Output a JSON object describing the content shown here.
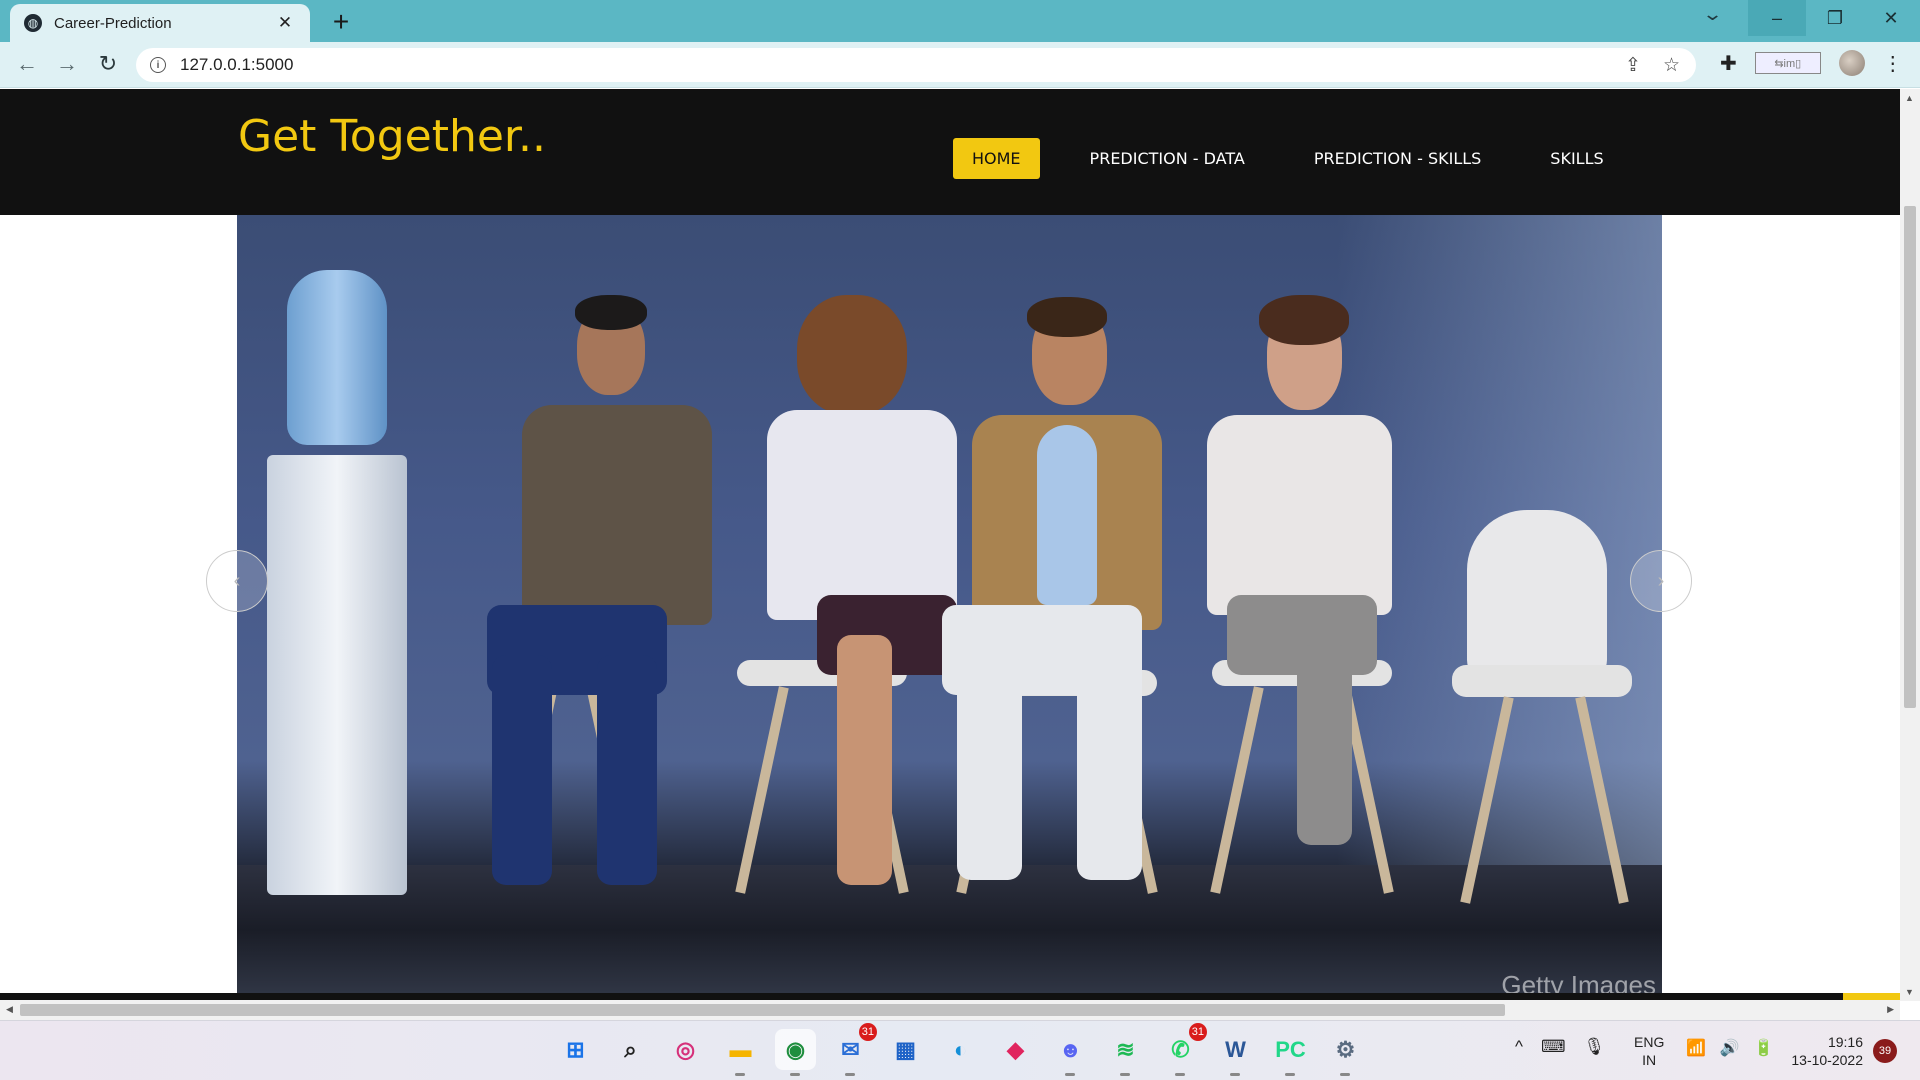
{
  "browser": {
    "tab_title": "Career-Prediction",
    "tab_close": "✕",
    "new_tab": "+",
    "url": "127.0.0.1:5000",
    "window_controls": {
      "minimize": "–",
      "maximize": "❐",
      "close": "✕"
    },
    "nav": {
      "back": "←",
      "forward": "→",
      "reload": "↻"
    },
    "omnibox_icons": {
      "share": "⇪",
      "bookmark": "☆"
    },
    "extension_badge": "⇆im▯"
  },
  "site": {
    "logo": "Get Together..",
    "nav": [
      {
        "label": "HOME",
        "active": true
      },
      {
        "label": "PREDICTION - DATA",
        "active": false
      },
      {
        "label": "PREDICTION - SKILLS",
        "active": false
      },
      {
        "label": "SKILLS",
        "active": false
      }
    ],
    "hero": {
      "watermark": "Getty Images",
      "prev": "‹",
      "next": "›"
    },
    "colors": {
      "accent": "#f2c811",
      "header_bg": "#111111"
    }
  },
  "taskbar": {
    "apps": [
      {
        "name": "start-icon",
        "glyph": "⊞",
        "color": "#1a73e8"
      },
      {
        "name": "search-icon",
        "glyph": "⌕",
        "color": "#222"
      },
      {
        "name": "instagram-icon",
        "glyph": "◎",
        "color": "#d6307a"
      },
      {
        "name": "file-explorer-icon",
        "glyph": "▬",
        "color": "#f5b400"
      },
      {
        "name": "chrome-icon",
        "glyph": "◉",
        "color": "#1e8e3e"
      },
      {
        "name": "mail-icon",
        "glyph": "✉",
        "color": "#2b6fd6",
        "badge": "31"
      },
      {
        "name": "store-icon",
        "glyph": "▦",
        "color": "#1e63c7"
      },
      {
        "name": "edge-icon",
        "glyph": "◐",
        "color": "#1590d8"
      },
      {
        "name": "media-app-icon",
        "glyph": "◆",
        "color": "#e0245e"
      },
      {
        "name": "discord-icon",
        "glyph": "☻",
        "color": "#5865f2"
      },
      {
        "name": "spotify-icon",
        "glyph": "≋",
        "color": "#1db954"
      },
      {
        "name": "whatsapp-icon",
        "glyph": "✆",
        "color": "#25d366",
        "badge": "31"
      },
      {
        "name": "word-icon",
        "glyph": "W",
        "color": "#2b5797"
      },
      {
        "name": "pycharm-icon",
        "glyph": "PC",
        "color": "#21d789"
      },
      {
        "name": "settings-icon",
        "glyph": "⚙",
        "color": "#5a6b80"
      }
    ],
    "tray": {
      "chevron": "^",
      "keyboard": "⌨",
      "mic": "🎙"
    },
    "lang_line1": "ENG",
    "lang_line2": "IN",
    "tray_icons": {
      "wifi": "📶",
      "volume": "🔊",
      "battery": "🔋"
    },
    "time": "19:16",
    "date": "13-10-2022",
    "notifications": "39"
  }
}
